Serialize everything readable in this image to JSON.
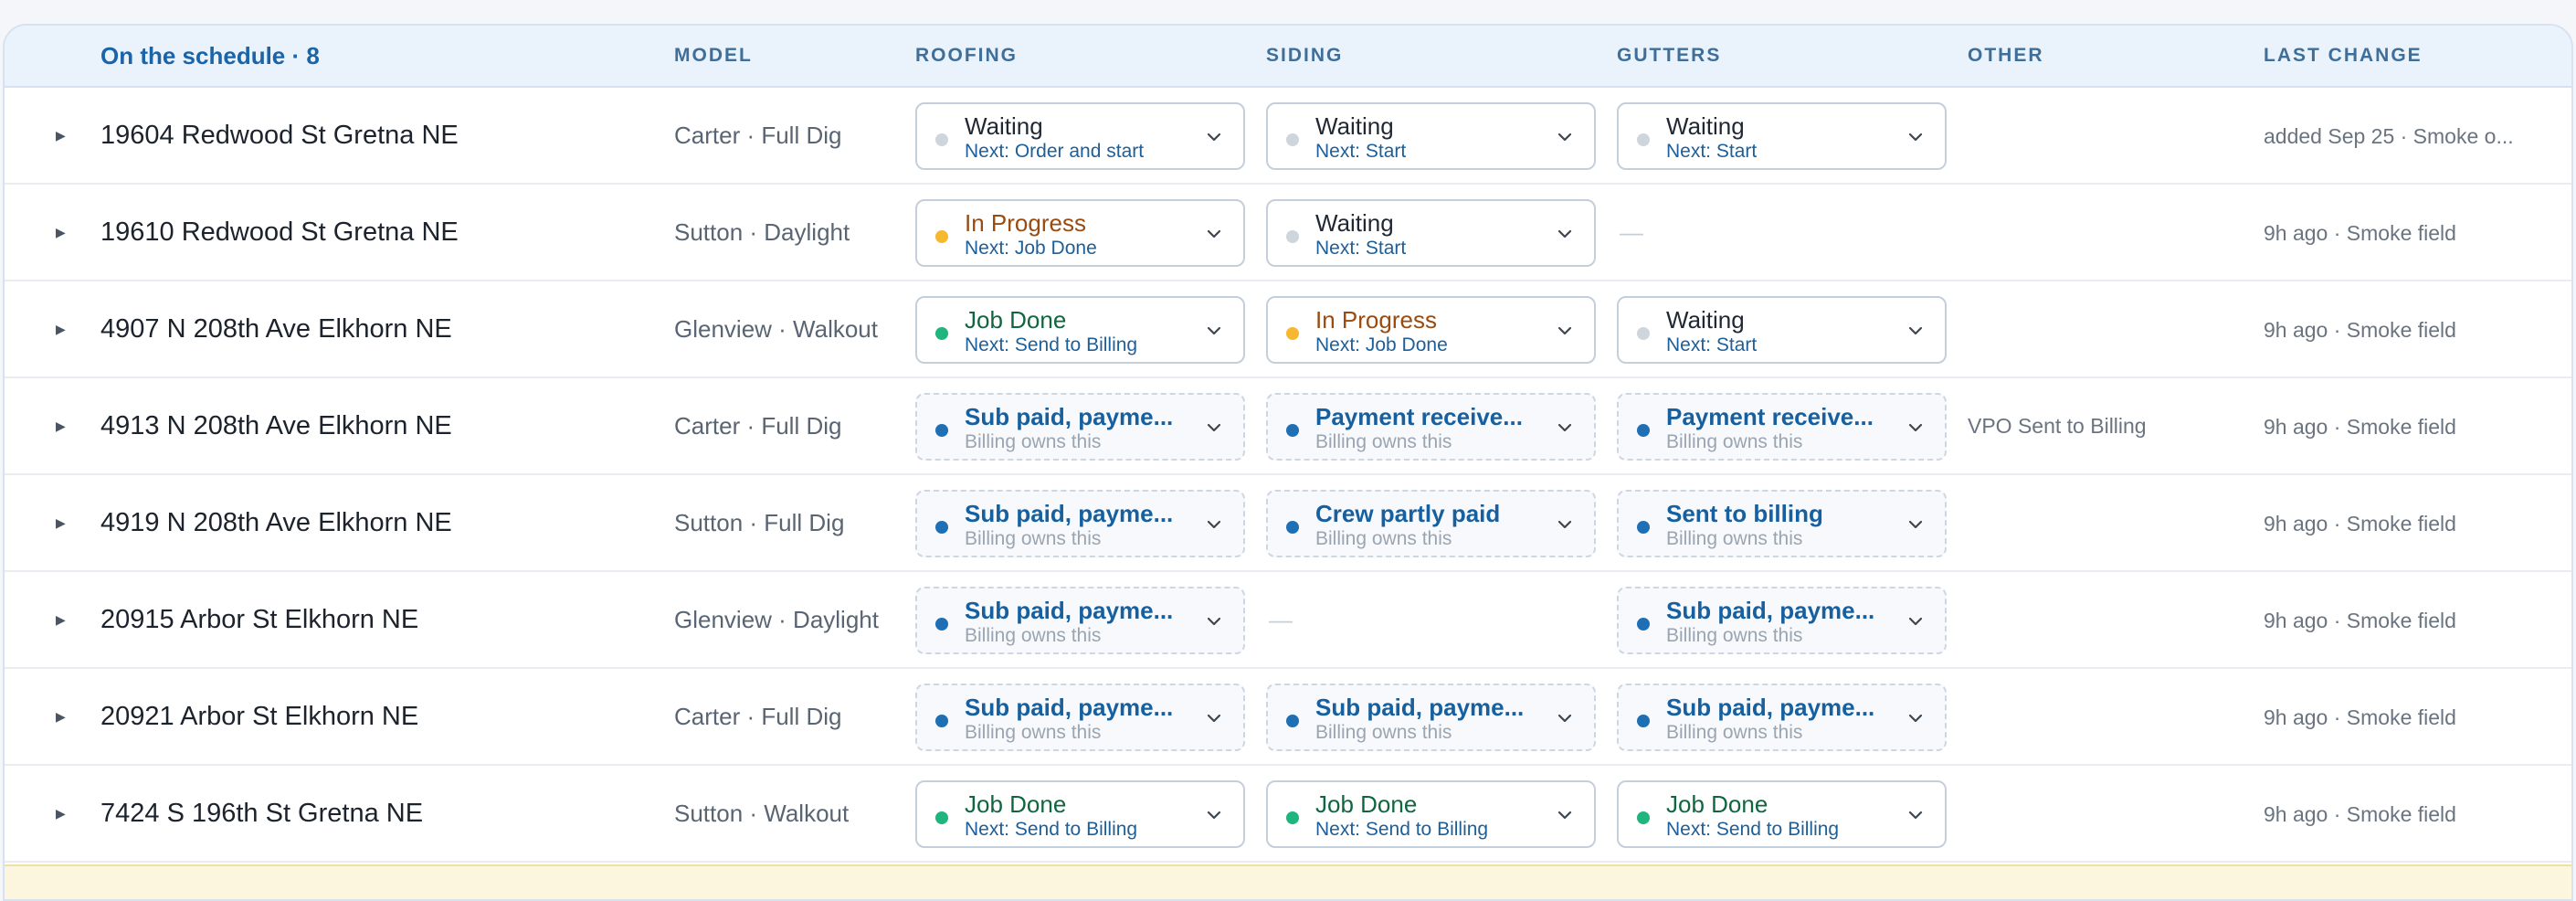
{
  "header": {
    "title": "On the schedule · 8",
    "columns": {
      "model": "MODEL",
      "roofing": "ROOFING",
      "siding": "SIDING",
      "gutters": "GUTTERS",
      "other": "OTHER",
      "last_change": "LAST CHANGE"
    }
  },
  "colors": {
    "waiting": "#cfd5dd",
    "in_progress": "#f5b82e",
    "job_done": "#1fb57c",
    "billing": "#1f6fb5"
  },
  "rows": [
    {
      "address": "19604 Redwood St Gretna NE",
      "model": "Carter · Full Dig",
      "roofing": {
        "state": "waiting",
        "status": "Waiting",
        "sub": "Next: Order and start"
      },
      "siding": {
        "state": "waiting",
        "status": "Waiting",
        "sub": "Next: Start"
      },
      "gutters": {
        "state": "waiting",
        "status": "Waiting",
        "sub": "Next: Start"
      },
      "other": "",
      "last_change": "added Sep 25 · Smoke o..."
    },
    {
      "address": "19610 Redwood St Gretna NE",
      "model": "Sutton · Daylight",
      "roofing": {
        "state": "progress",
        "status": "In Progress",
        "sub": "Next: Job Done"
      },
      "siding": {
        "state": "waiting",
        "status": "Waiting",
        "sub": "Next: Start"
      },
      "gutters": null,
      "other": "",
      "last_change": "9h ago · Smoke field"
    },
    {
      "address": "4907 N 208th Ave Elkhorn NE",
      "model": "Glenview · Walkout",
      "roofing": {
        "state": "done",
        "status": "Job Done",
        "sub": "Next: Send to Billing"
      },
      "siding": {
        "state": "progress",
        "status": "In Progress",
        "sub": "Next: Job Done"
      },
      "gutters": {
        "state": "waiting",
        "status": "Waiting",
        "sub": "Next: Start"
      },
      "other": "",
      "last_change": "9h ago · Smoke field"
    },
    {
      "address": "4913 N 208th Ave Elkhorn NE",
      "model": "Carter · Full Dig",
      "roofing": {
        "state": "billing",
        "status": "Sub paid, payme...",
        "sub": "Billing owns this"
      },
      "siding": {
        "state": "billing",
        "status": "Payment receive...",
        "sub": "Billing owns this"
      },
      "gutters": {
        "state": "billing",
        "status": "Payment receive...",
        "sub": "Billing owns this"
      },
      "other": "VPO Sent to Billing",
      "last_change": "9h ago · Smoke field"
    },
    {
      "address": "4919 N 208th Ave Elkhorn NE",
      "model": "Sutton · Full Dig",
      "roofing": {
        "state": "billing",
        "status": "Sub paid, payme...",
        "sub": "Billing owns this"
      },
      "siding": {
        "state": "billing",
        "status": "Crew partly paid",
        "sub": "Billing owns this"
      },
      "gutters": {
        "state": "billing",
        "status": "Sent to billing",
        "sub": "Billing owns this"
      },
      "other": "",
      "last_change": "9h ago · Smoke field"
    },
    {
      "address": "20915 Arbor St Elkhorn NE",
      "model": "Glenview · Daylight",
      "roofing": {
        "state": "billing",
        "status": "Sub paid, payme...",
        "sub": "Billing owns this"
      },
      "siding": null,
      "gutters": {
        "state": "billing",
        "status": "Sub paid, payme...",
        "sub": "Billing owns this"
      },
      "other": "",
      "last_change": "9h ago · Smoke field"
    },
    {
      "address": "20921 Arbor St Elkhorn NE",
      "model": "Carter · Full Dig",
      "roofing": {
        "state": "billing",
        "status": "Sub paid, payme...",
        "sub": "Billing owns this"
      },
      "siding": {
        "state": "billing",
        "status": "Sub paid, payme...",
        "sub": "Billing owns this"
      },
      "gutters": {
        "state": "billing",
        "status": "Sub paid, payme...",
        "sub": "Billing owns this"
      },
      "other": "",
      "last_change": "9h ago · Smoke field"
    },
    {
      "address": "7424 S 196th St Gretna NE",
      "model": "Sutton · Walkout",
      "roofing": {
        "state": "done",
        "status": "Job Done",
        "sub": "Next: Send to Billing"
      },
      "siding": {
        "state": "done",
        "status": "Job Done",
        "sub": "Next: Send to Billing"
      },
      "gutters": {
        "state": "done",
        "status": "Job Done",
        "sub": "Next: Send to Billing"
      },
      "other": "",
      "last_change": "9h ago · Smoke field"
    }
  ],
  "empty_cell": "—",
  "icons": {
    "expand": "caret-right-icon",
    "dropdown": "chevron-down-icon",
    "status": "status-dot-icon"
  }
}
